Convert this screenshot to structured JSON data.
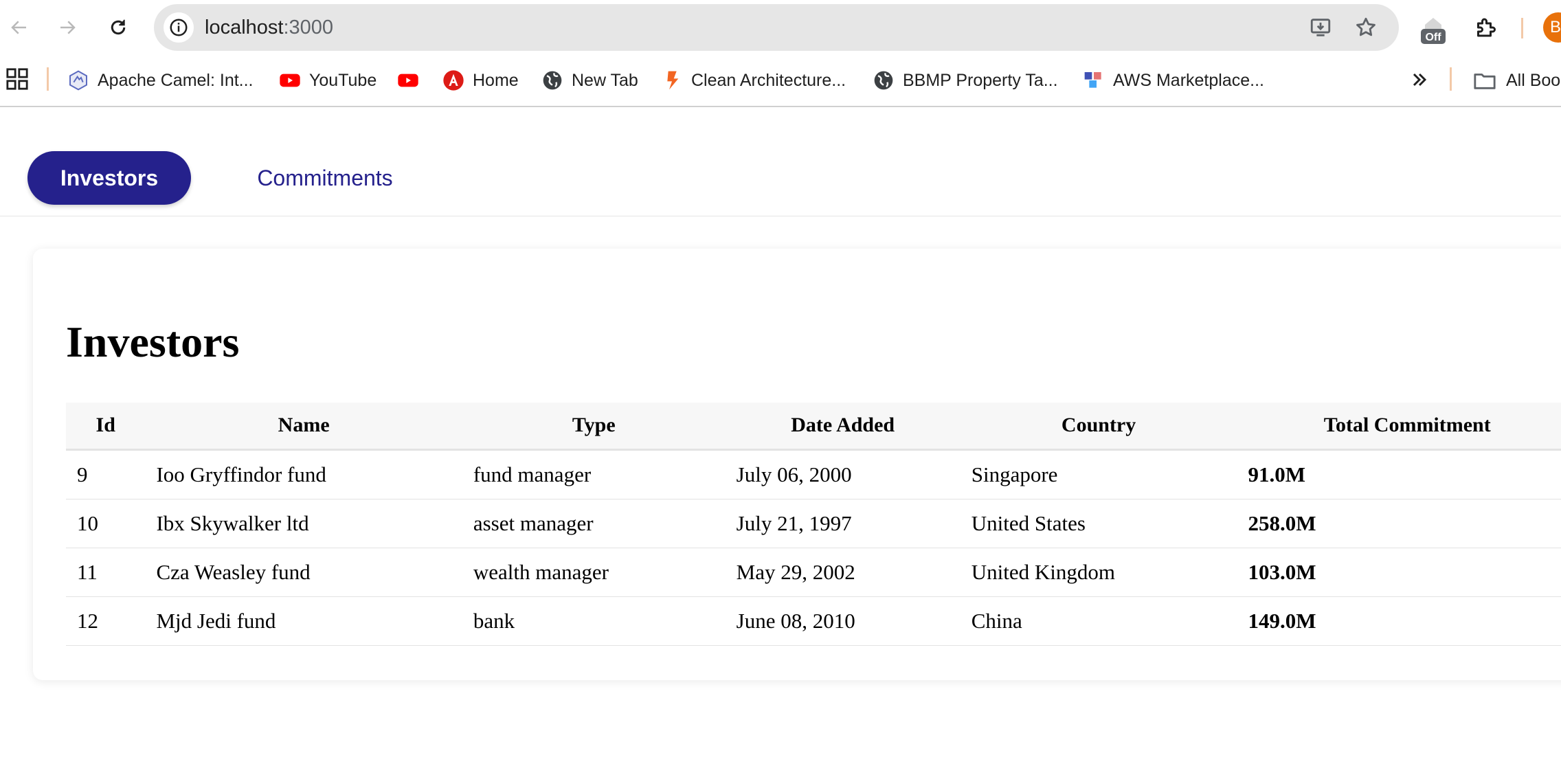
{
  "browser": {
    "url_host": "localhost",
    "url_port": ":3000",
    "extension_badge": "Off",
    "avatar_initial": "B"
  },
  "bookmarks": [
    {
      "label": "Apache Camel: Int...",
      "icon": "apache-camel-icon"
    },
    {
      "label": "YouTube",
      "icon": "youtube-icon"
    },
    {
      "label": "",
      "icon": "youtube-icon"
    },
    {
      "label": "Home",
      "icon": "angular-icon"
    },
    {
      "label": "New Tab",
      "icon": "globe-icon"
    },
    {
      "label": "Clean Architecture...",
      "icon": "bookmark-orange-icon"
    },
    {
      "label": "BBMP Property Ta...",
      "icon": "globe-icon"
    },
    {
      "label": "AWS Marketplace...",
      "icon": "aws-cubes-icon"
    }
  ],
  "all_bookmarks_label": "All Boo",
  "nav": {
    "tabs": [
      {
        "label": "Investors",
        "active": true
      },
      {
        "label": "Commitments",
        "active": false
      }
    ]
  },
  "page": {
    "title": "Investors"
  },
  "table": {
    "columns": [
      "Id",
      "Name",
      "Type",
      "Date Added",
      "Country",
      "Total Commitment"
    ],
    "rows": [
      {
        "id": "9",
        "name": "Ioo Gryffindor fund",
        "type": "fund manager",
        "date_added": "July 06, 2000",
        "country": "Singapore",
        "total_commitment": "91.0M"
      },
      {
        "id": "10",
        "name": "Ibx Skywalker ltd",
        "type": "asset manager",
        "date_added": "July 21, 1997",
        "country": "United States",
        "total_commitment": "258.0M"
      },
      {
        "id": "11",
        "name": "Cza Weasley fund",
        "type": "wealth manager",
        "date_added": "May 29, 2002",
        "country": "United Kingdom",
        "total_commitment": "103.0M"
      },
      {
        "id": "12",
        "name": "Mjd Jedi fund",
        "type": "bank",
        "date_added": "June 08, 2010",
        "country": "China",
        "total_commitment": "149.0M"
      }
    ]
  },
  "colors": {
    "accent": "#25218c",
    "commitment_text": "#2a19c8"
  }
}
